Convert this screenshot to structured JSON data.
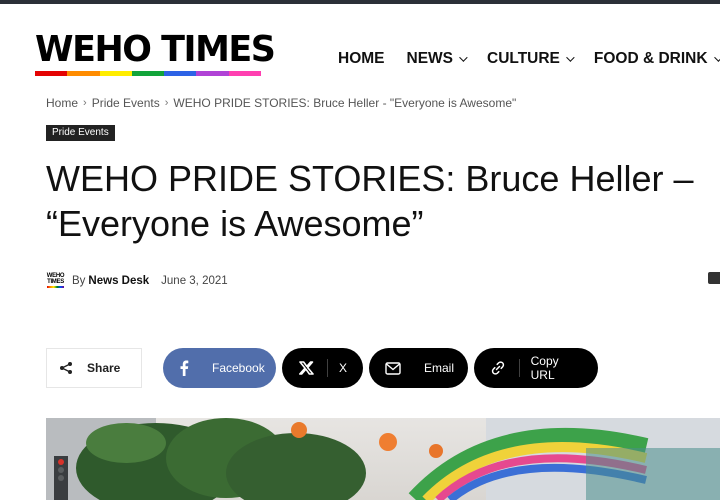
{
  "site": {
    "logo_text": "WEHO TIMES",
    "stripe_colors": [
      "#e40303",
      "#ff8c00",
      "#ffed00",
      "#12a43a",
      "#2d63e6",
      "#b043d6",
      "#ff3fb0"
    ]
  },
  "nav": {
    "items": [
      {
        "label": "HOME",
        "has_dropdown": false
      },
      {
        "label": "NEWS",
        "has_dropdown": true
      },
      {
        "label": "CULTURE",
        "has_dropdown": true
      },
      {
        "label": "FOOD & DRINK",
        "has_dropdown": true
      }
    ]
  },
  "breadcrumb": {
    "items": [
      "Home",
      "Pride Events",
      "WEHO PRIDE STORIES: Bruce Heller - \"Everyone is Awesome\""
    ]
  },
  "article": {
    "category": "Pride Events",
    "title": "WEHO PRIDE STORIES: Bruce Heller – “Everyone is Awesome”",
    "by_label": "By",
    "author": "News Desk",
    "date": "June 3, 2021",
    "avatar_text_1": "WEHO",
    "avatar_text_2": "TIMES"
  },
  "share": {
    "label": "Share",
    "buttons": [
      {
        "label": "Facebook",
        "icon": "facebook-icon",
        "color": "#516eab"
      },
      {
        "label": "X",
        "icon": "x-icon",
        "color": "#000000"
      },
      {
        "label": "Email",
        "icon": "mail-icon",
        "color": "#000000"
      },
      {
        "label": "Copy URL",
        "icon": "link-icon",
        "color": "#000000"
      }
    ]
  }
}
